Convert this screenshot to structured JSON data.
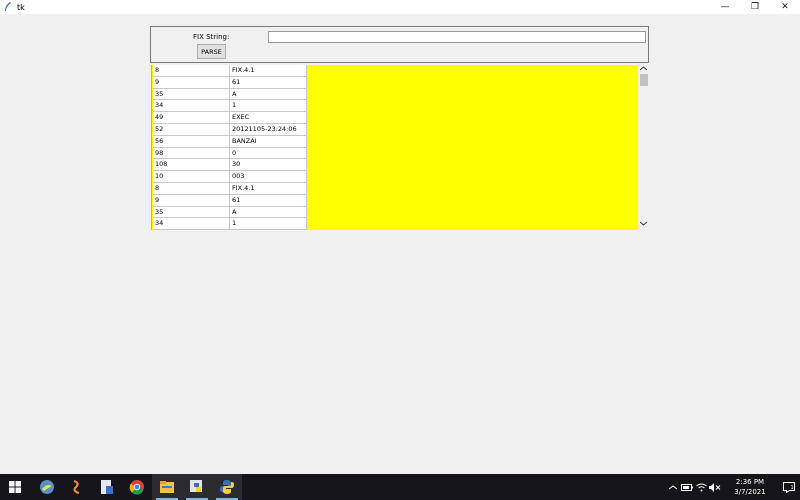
{
  "window": {
    "title": "tk",
    "minimize": "—",
    "restore": "❐",
    "close": "✕"
  },
  "form": {
    "fix_label": "FIX String:",
    "fix_value": "",
    "parse_label": "PARSE"
  },
  "rows": [
    {
      "tag": "8",
      "value": "FIX.4.1"
    },
    {
      "tag": "9",
      "value": "61"
    },
    {
      "tag": "35",
      "value": "A"
    },
    {
      "tag": "34",
      "value": "1"
    },
    {
      "tag": "49",
      "value": "EXEC"
    },
    {
      "tag": "52",
      "value": "20121105-23:24:06"
    },
    {
      "tag": "56",
      "value": "BANZAI"
    },
    {
      "tag": "98",
      "value": "0"
    },
    {
      "tag": "108",
      "value": "30"
    },
    {
      "tag": "10",
      "value": "003"
    },
    {
      "tag": "8",
      "value": "FIX.4.1"
    },
    {
      "tag": "9",
      "value": "61"
    },
    {
      "tag": "35",
      "value": "A"
    },
    {
      "tag": "34",
      "value": "1"
    }
  ],
  "colors": {
    "table_background": "#ffff00",
    "taskbar": "#16161a"
  },
  "taskbar": {
    "icons": [
      "windows-start-icon",
      "app-bird-icon",
      "eclipse-icon",
      "file-doc-icon",
      "chrome-icon",
      "file-explorer-icon",
      "python-idle-icon",
      "python-icon"
    ],
    "clock_time": "2:36 PM",
    "clock_date": "3/7/2021"
  }
}
